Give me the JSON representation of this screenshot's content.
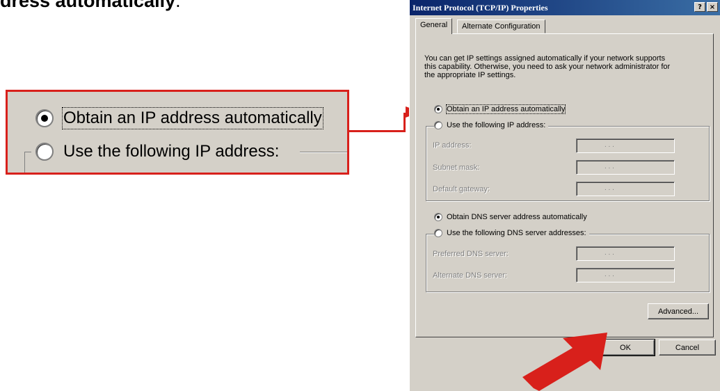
{
  "heading_fragment": {
    "text": "dress automatically",
    "punct": "."
  },
  "zoom": {
    "option1": "Obtain an IP address automatically",
    "option2": "Use the following IP address:"
  },
  "dialog": {
    "title": "Internet Protocol (TCP/IP) Properties",
    "help_button": "?",
    "close_button": "×",
    "tabs": [
      "General",
      "Alternate Configuration"
    ],
    "description": [
      "You can get IP settings assigned automatically if your network supports",
      "this capability. Otherwise, you need to ask your network administrator for",
      "the appropriate IP settings."
    ],
    "ip_auto_label": "Obtain an IP address automatically",
    "ip_manual_label": "Use the following IP address:",
    "ip_fields": [
      "IP address:",
      "Subnet mask:",
      "Default gateway:"
    ],
    "dns_auto_label": "Obtain DNS server address automatically",
    "dns_manual_label": "Use the following DNS server addresses:",
    "dns_fields": [
      "Preferred DNS server:",
      "Alternate DNS server:"
    ],
    "ip_dots": ". . .",
    "advanced_button": "Advanced...",
    "ok_button": "OK",
    "cancel_button": "Cancel"
  },
  "colors": {
    "accent_red": "#d8201b",
    "dialog_face": "#d4d0c8",
    "title_blue": "#0a246a"
  }
}
